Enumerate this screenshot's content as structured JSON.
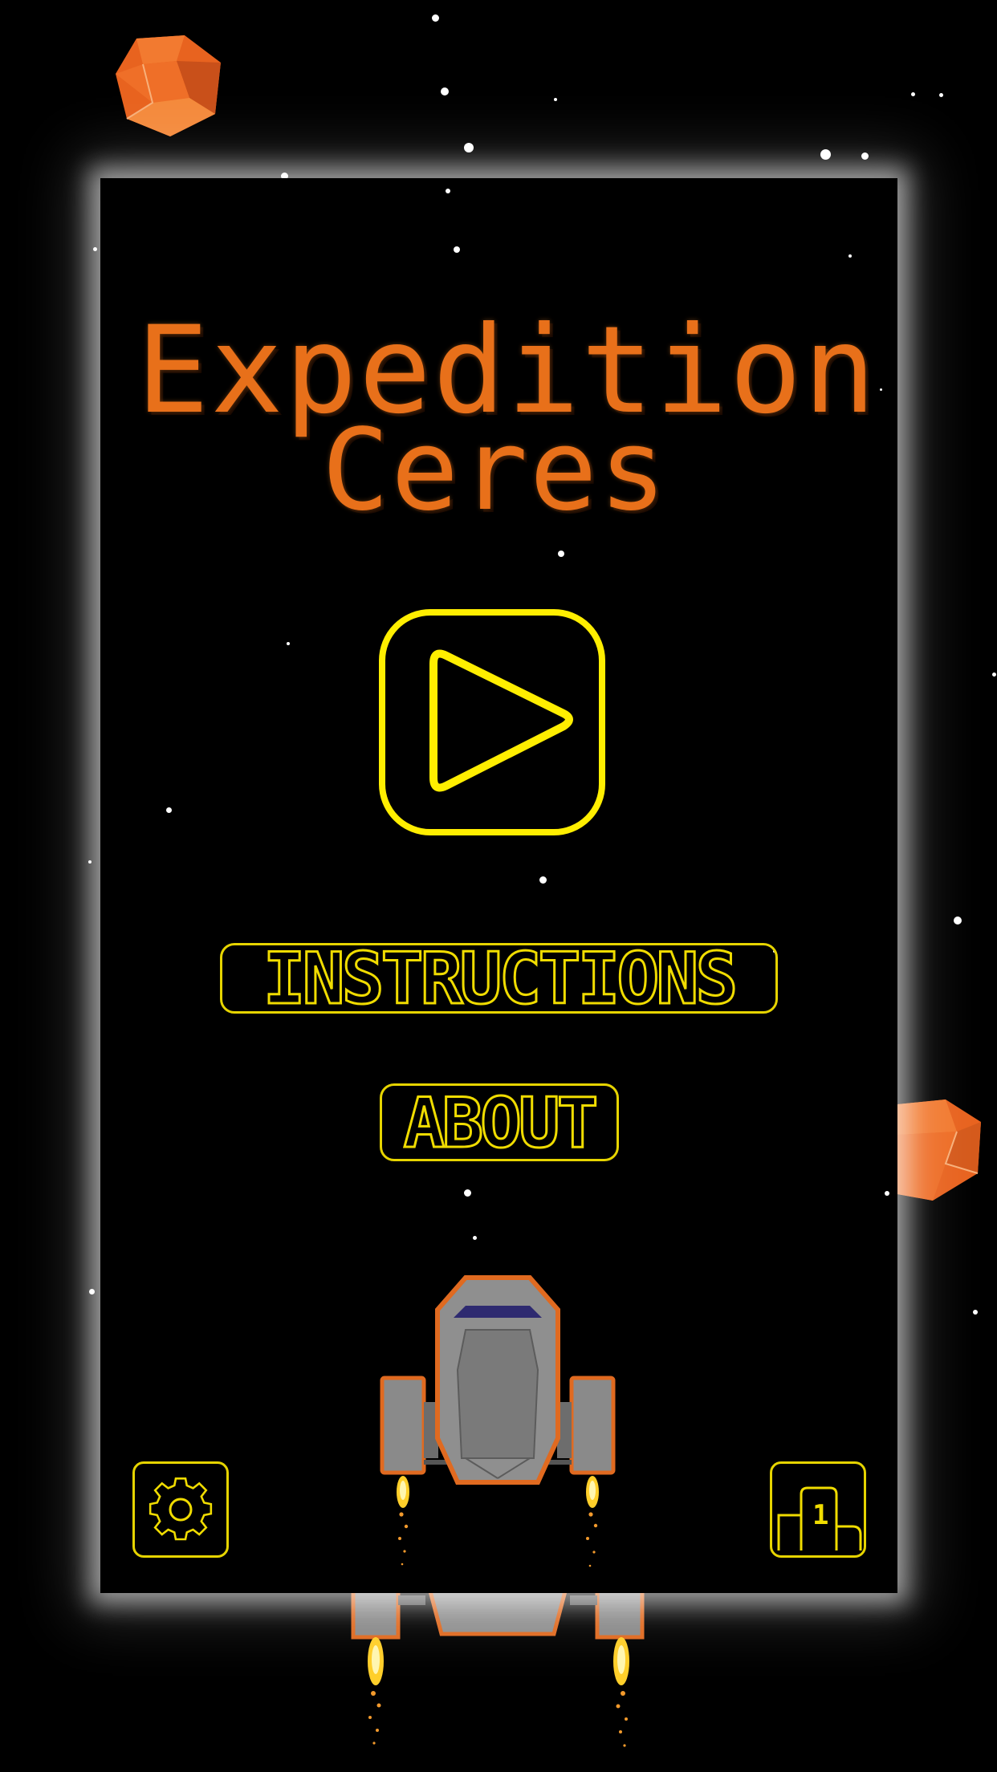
{
  "app": {
    "title_line1": "Expedition",
    "title_line2": "Ceres"
  },
  "menu": {
    "play_icon": "play-icon",
    "instructions_label": "INSTRUCTIONS",
    "about_label": "ABOUT"
  },
  "footer": {
    "settings_icon": "gear-icon",
    "leaderboard_icon": "podium-icon",
    "leaderboard_rank": "1"
  },
  "colors": {
    "title": "#e8701a",
    "button_outline": "#ffee00",
    "background": "#000000",
    "asteroid": "#e8631f"
  }
}
